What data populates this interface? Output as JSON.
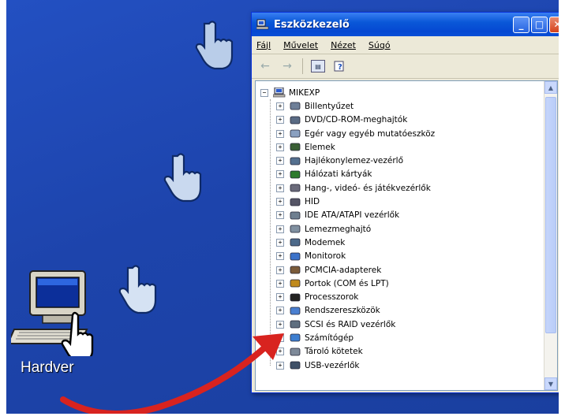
{
  "window": {
    "title": "Eszközkezelő",
    "menu": [
      "Fájl",
      "Művelet",
      "Nézet",
      "Súgó"
    ],
    "controls": {
      "minimize": "_",
      "maximize": "□",
      "close": "✕"
    }
  },
  "desktop": {
    "icon_label": "Hardver"
  },
  "tree": {
    "root": "MIKEXP",
    "items": [
      {
        "label": "Billentyűzet",
        "icon": "keyboard-icon"
      },
      {
        "label": "DVD/CD-ROM-meghajtók",
        "icon": "cd-drive-icon"
      },
      {
        "label": "Egér vagy egyéb mutatóeszköz",
        "icon": "mouse-icon"
      },
      {
        "label": "Elemek",
        "icon": "battery-icon"
      },
      {
        "label": "Hajlékonylemez-vezérlő",
        "icon": "floppy-controller-icon"
      },
      {
        "label": "Hálózati kártyák",
        "icon": "network-card-icon"
      },
      {
        "label": "Hang-, videó- és játékvezérlők",
        "icon": "sound-icon"
      },
      {
        "label": "HID",
        "icon": "hid-icon"
      },
      {
        "label": "IDE ATA/ATAPI vezérlők",
        "icon": "ide-controller-icon"
      },
      {
        "label": "Lemezmeghajtó",
        "icon": "disk-drive-icon"
      },
      {
        "label": "Modemek",
        "icon": "modem-icon"
      },
      {
        "label": "Monitorok",
        "icon": "monitor-icon"
      },
      {
        "label": "PCMCIA-adapterek",
        "icon": "pcmcia-icon"
      },
      {
        "label": "Portok (COM és LPT)",
        "icon": "port-icon"
      },
      {
        "label": "Processzorok",
        "icon": "processor-icon"
      },
      {
        "label": "Rendszereszközök",
        "icon": "system-device-icon"
      },
      {
        "label": "SCSI és RAID vezérlők",
        "icon": "scsi-icon"
      },
      {
        "label": "Számítógép",
        "icon": "computer-icon"
      },
      {
        "label": "Tároló kötetek",
        "icon": "storage-volume-icon"
      },
      {
        "label": "USB-vezérlők",
        "icon": "usb-icon"
      }
    ]
  },
  "colors": {
    "desktop": "#1f46b0",
    "titlebar": "#0a58d8",
    "arrow": "#d8231f"
  }
}
